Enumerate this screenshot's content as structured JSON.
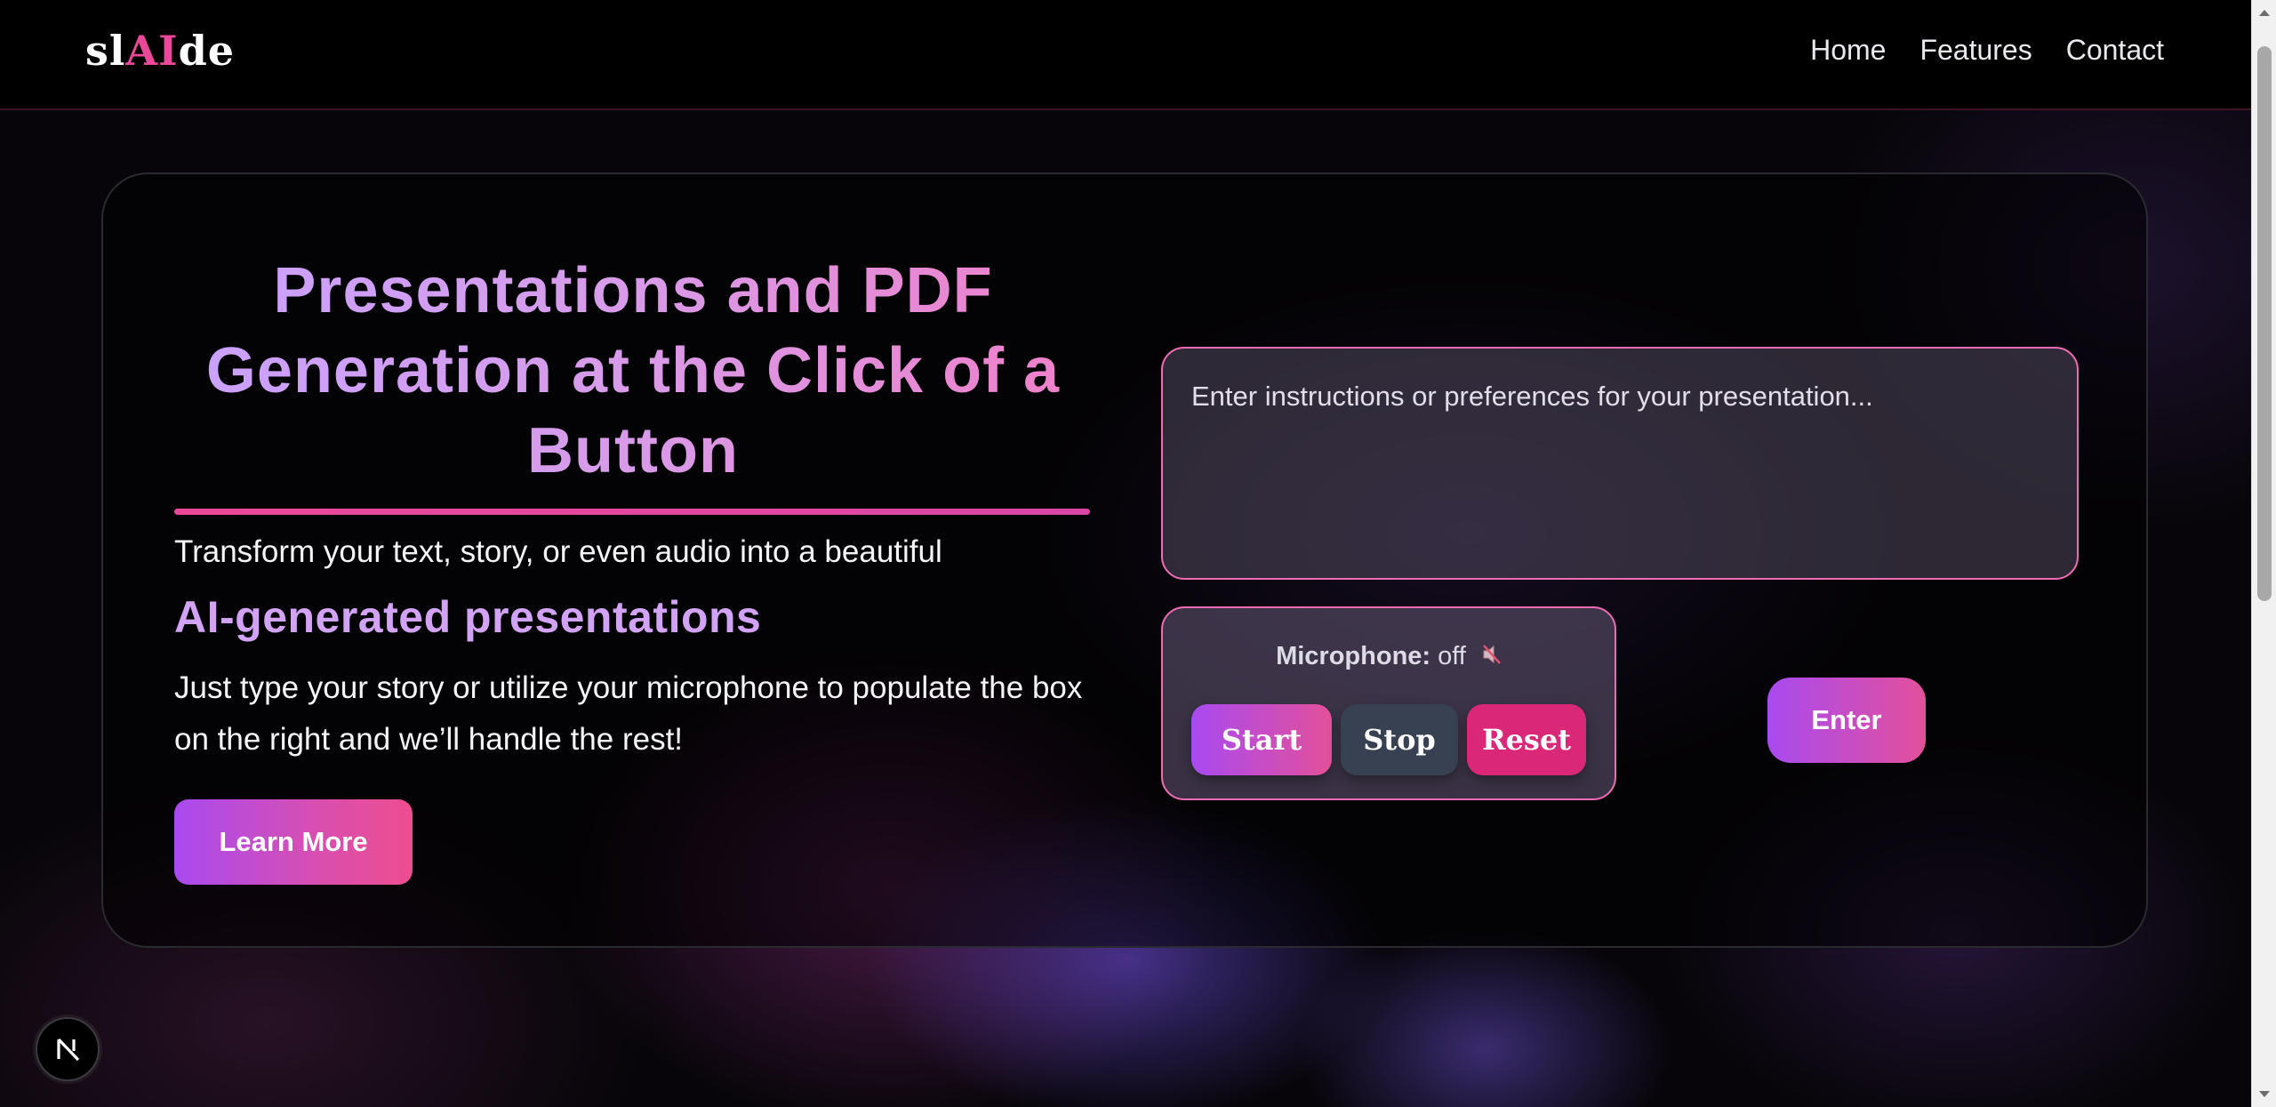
{
  "brand": {
    "logo_prefix": "sl",
    "logo_ai": "AI",
    "logo_suffix": "de",
    "accent_color": "#ec4899"
  },
  "nav": {
    "items": [
      {
        "label": "Home"
      },
      {
        "label": "Features"
      },
      {
        "label": "Contact"
      }
    ]
  },
  "hero": {
    "headline": "Presentations and PDF Generation at the Click of a Button",
    "lead": "Transform your text, story, or even audio into a beautiful",
    "subhead": "AI-generated presentations",
    "body": "Just type your story or utilize your microphone to populate the box on the right and we’ll handle the rest!",
    "learn_more_label": "Learn More"
  },
  "prompt": {
    "placeholder": "Enter instructions or preferences for your presentation...",
    "value": ""
  },
  "microphone": {
    "label": "Microphone:",
    "status": "off",
    "status_icon": "muted-speaker-icon",
    "start_label": "Start",
    "stop_label": "Stop",
    "reset_label": "Reset"
  },
  "enter_label": "Enter",
  "colors": {
    "gradient_start": "#a94af0",
    "gradient_end": "#ec4899",
    "stop_button": "#374151",
    "reset_button": "#db2777"
  }
}
